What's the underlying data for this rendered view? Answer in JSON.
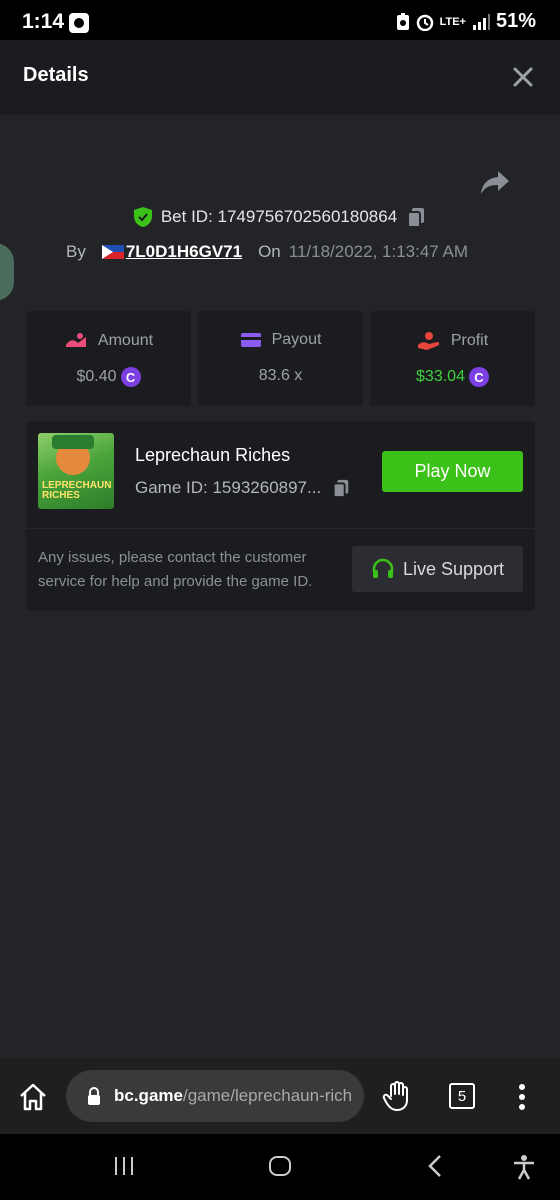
{
  "status_bar": {
    "time": "1:14",
    "network": "LTE+",
    "battery": "51%"
  },
  "header": {
    "title": "Details"
  },
  "bet": {
    "bet_id_label": "Bet ID: 1749756702560180864",
    "by_label": "By",
    "username": "7L0D1H6GV71",
    "on_label": "On",
    "datetime": "11/18/2022, 1:13:47 AM"
  },
  "stats": [
    {
      "label": "Amount",
      "value": "$0.40",
      "icon": "amount-icon",
      "color": "#ec4d7a"
    },
    {
      "label": "Payout",
      "value": "83.6 x",
      "icon": "payout-card-icon",
      "color": "#8a5cf0"
    },
    {
      "label": "Profit",
      "value": "$33.04",
      "icon": "profit-hand-icon",
      "color": "#e8453c"
    }
  ],
  "coin_symbol": "C",
  "game": {
    "name": "Leprechaun Riches",
    "game_id": "Game ID: 1593260897...",
    "play_label": "Play Now",
    "thumb_text": "LEPRECHAUN RICHES",
    "support_text": "Any issues, please contact the customer service for help and provide the game ID.",
    "live_support_label": "Live Support"
  },
  "browser": {
    "url_host": "bc.game",
    "url_path": "/game/leprechaun-rich",
    "tab_count": "5"
  },
  "colors": {
    "accent_green": "#3bc117",
    "profit_green": "#3ed13c",
    "coin_purple": "#7b3fe4",
    "panel": "#1b1c20",
    "background": "#232428"
  }
}
